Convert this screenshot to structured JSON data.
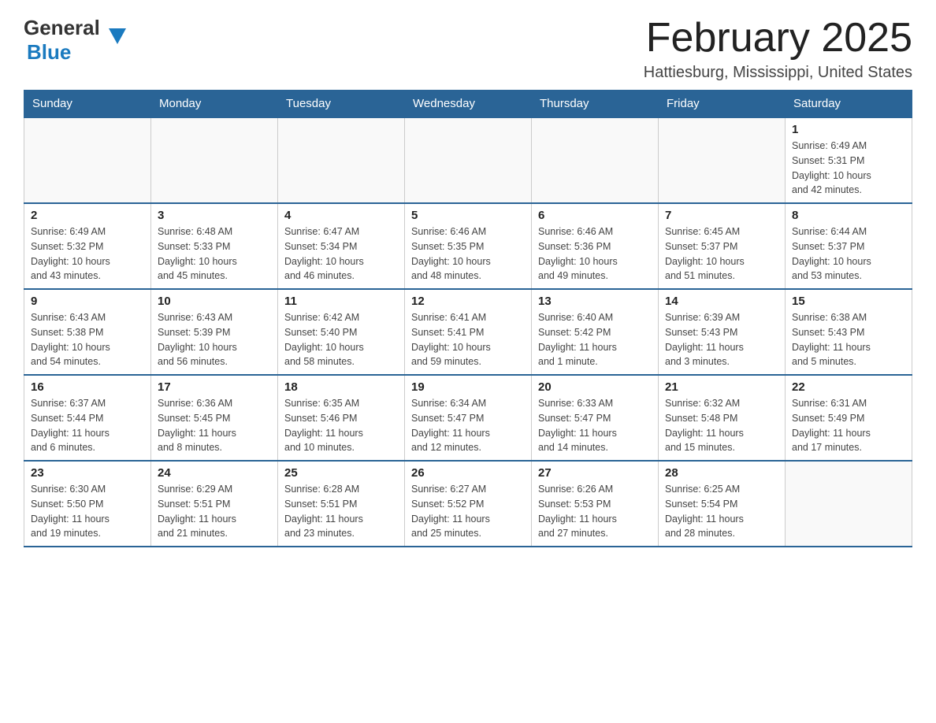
{
  "header": {
    "logo_general": "General",
    "logo_blue": "Blue",
    "month_title": "February 2025",
    "location": "Hattiesburg, Mississippi, United States"
  },
  "weekdays": [
    "Sunday",
    "Monday",
    "Tuesday",
    "Wednesday",
    "Thursday",
    "Friday",
    "Saturday"
  ],
  "weeks": [
    [
      {
        "day": "",
        "info": ""
      },
      {
        "day": "",
        "info": ""
      },
      {
        "day": "",
        "info": ""
      },
      {
        "day": "",
        "info": ""
      },
      {
        "day": "",
        "info": ""
      },
      {
        "day": "",
        "info": ""
      },
      {
        "day": "1",
        "info": "Sunrise: 6:49 AM\nSunset: 5:31 PM\nDaylight: 10 hours\nand 42 minutes."
      }
    ],
    [
      {
        "day": "2",
        "info": "Sunrise: 6:49 AM\nSunset: 5:32 PM\nDaylight: 10 hours\nand 43 minutes."
      },
      {
        "day": "3",
        "info": "Sunrise: 6:48 AM\nSunset: 5:33 PM\nDaylight: 10 hours\nand 45 minutes."
      },
      {
        "day": "4",
        "info": "Sunrise: 6:47 AM\nSunset: 5:34 PM\nDaylight: 10 hours\nand 46 minutes."
      },
      {
        "day": "5",
        "info": "Sunrise: 6:46 AM\nSunset: 5:35 PM\nDaylight: 10 hours\nand 48 minutes."
      },
      {
        "day": "6",
        "info": "Sunrise: 6:46 AM\nSunset: 5:36 PM\nDaylight: 10 hours\nand 49 minutes."
      },
      {
        "day": "7",
        "info": "Sunrise: 6:45 AM\nSunset: 5:37 PM\nDaylight: 10 hours\nand 51 minutes."
      },
      {
        "day": "8",
        "info": "Sunrise: 6:44 AM\nSunset: 5:37 PM\nDaylight: 10 hours\nand 53 minutes."
      }
    ],
    [
      {
        "day": "9",
        "info": "Sunrise: 6:43 AM\nSunset: 5:38 PM\nDaylight: 10 hours\nand 54 minutes."
      },
      {
        "day": "10",
        "info": "Sunrise: 6:43 AM\nSunset: 5:39 PM\nDaylight: 10 hours\nand 56 minutes."
      },
      {
        "day": "11",
        "info": "Sunrise: 6:42 AM\nSunset: 5:40 PM\nDaylight: 10 hours\nand 58 minutes."
      },
      {
        "day": "12",
        "info": "Sunrise: 6:41 AM\nSunset: 5:41 PM\nDaylight: 10 hours\nand 59 minutes."
      },
      {
        "day": "13",
        "info": "Sunrise: 6:40 AM\nSunset: 5:42 PM\nDaylight: 11 hours\nand 1 minute."
      },
      {
        "day": "14",
        "info": "Sunrise: 6:39 AM\nSunset: 5:43 PM\nDaylight: 11 hours\nand 3 minutes."
      },
      {
        "day": "15",
        "info": "Sunrise: 6:38 AM\nSunset: 5:43 PM\nDaylight: 11 hours\nand 5 minutes."
      }
    ],
    [
      {
        "day": "16",
        "info": "Sunrise: 6:37 AM\nSunset: 5:44 PM\nDaylight: 11 hours\nand 6 minutes."
      },
      {
        "day": "17",
        "info": "Sunrise: 6:36 AM\nSunset: 5:45 PM\nDaylight: 11 hours\nand 8 minutes."
      },
      {
        "day": "18",
        "info": "Sunrise: 6:35 AM\nSunset: 5:46 PM\nDaylight: 11 hours\nand 10 minutes."
      },
      {
        "day": "19",
        "info": "Sunrise: 6:34 AM\nSunset: 5:47 PM\nDaylight: 11 hours\nand 12 minutes."
      },
      {
        "day": "20",
        "info": "Sunrise: 6:33 AM\nSunset: 5:47 PM\nDaylight: 11 hours\nand 14 minutes."
      },
      {
        "day": "21",
        "info": "Sunrise: 6:32 AM\nSunset: 5:48 PM\nDaylight: 11 hours\nand 15 minutes."
      },
      {
        "day": "22",
        "info": "Sunrise: 6:31 AM\nSunset: 5:49 PM\nDaylight: 11 hours\nand 17 minutes."
      }
    ],
    [
      {
        "day": "23",
        "info": "Sunrise: 6:30 AM\nSunset: 5:50 PM\nDaylight: 11 hours\nand 19 minutes."
      },
      {
        "day": "24",
        "info": "Sunrise: 6:29 AM\nSunset: 5:51 PM\nDaylight: 11 hours\nand 21 minutes."
      },
      {
        "day": "25",
        "info": "Sunrise: 6:28 AM\nSunset: 5:51 PM\nDaylight: 11 hours\nand 23 minutes."
      },
      {
        "day": "26",
        "info": "Sunrise: 6:27 AM\nSunset: 5:52 PM\nDaylight: 11 hours\nand 25 minutes."
      },
      {
        "day": "27",
        "info": "Sunrise: 6:26 AM\nSunset: 5:53 PM\nDaylight: 11 hours\nand 27 minutes."
      },
      {
        "day": "28",
        "info": "Sunrise: 6:25 AM\nSunset: 5:54 PM\nDaylight: 11 hours\nand 28 minutes."
      },
      {
        "day": "",
        "info": ""
      }
    ]
  ]
}
